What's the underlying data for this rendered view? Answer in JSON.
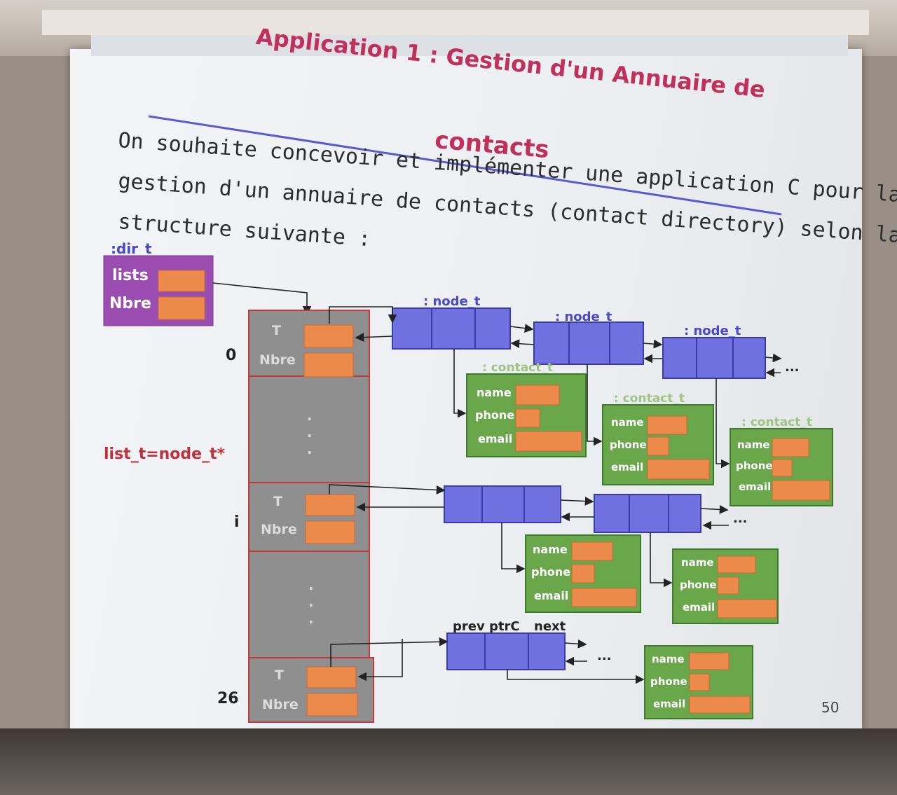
{
  "slide": {
    "title_line1": "Application 1 : Gestion d'un Annuaire de",
    "title_line2": "contacts",
    "body_lines": [
      "On souhaite concevoir et implémenter une application C pour la",
      "gestion d'un annuaire de contacts (contact directory) selon la",
      "structure suivante :"
    ],
    "slide_number": "50"
  },
  "diagram": {
    "dir_type": ":dir_t",
    "dir_fields": [
      "lists",
      "Nbre"
    ],
    "typedef": "list_t=node_t*",
    "table_rows": [
      {
        "index": "0",
        "field1": "T",
        "field2": "Nbre"
      },
      {
        "index": "i",
        "field1": "T",
        "field2": "Nbre"
      },
      {
        "index": "26",
        "field1": "T",
        "field2": "Nbre"
      }
    ],
    "ellipsis_vertical": ".",
    "node_type": ": node_t",
    "contact_type": ": contact_t",
    "node_fields": [
      "prev",
      "ptrC",
      "next"
    ],
    "contact_fields": [
      "name",
      "phone",
      "email"
    ],
    "continuation": "..."
  },
  "colors": {
    "dir": "#9a4cb0",
    "table": "#8f8f8f",
    "node": "#7070e0",
    "contact": "#6aa64a",
    "field": "#ec8a4c",
    "title": "#c0305a"
  }
}
